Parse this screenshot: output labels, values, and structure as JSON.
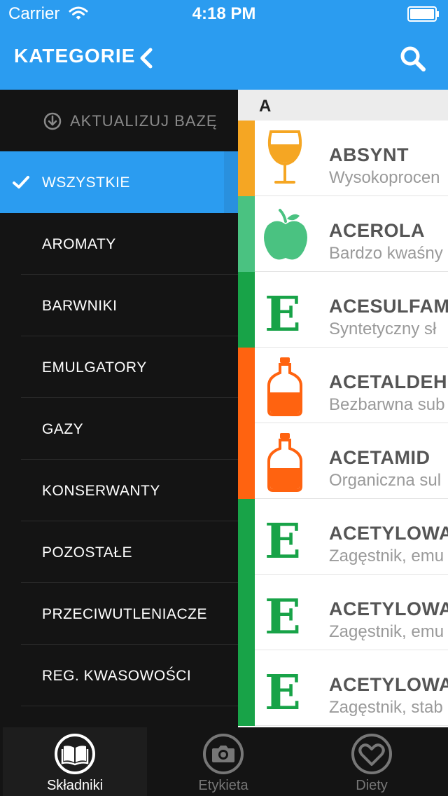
{
  "status_bar": {
    "carrier": "Carrier",
    "time": "4:18 PM"
  },
  "nav": {
    "title": "KATEGORIE"
  },
  "sidebar": {
    "update_label": "AKTUALIZUJ BAZĘ",
    "items": [
      {
        "label": "WSZYSTKIE",
        "active": true
      },
      {
        "label": "AROMATY"
      },
      {
        "label": "BARWNIKI"
      },
      {
        "label": "EMULGATORY"
      },
      {
        "label": "GAZY"
      },
      {
        "label": "KONSERWANTY"
      },
      {
        "label": "POZOSTAŁE"
      },
      {
        "label": "PRZECIWUTLENIACZE"
      },
      {
        "label": "REG. KWASOWOŚCI"
      }
    ]
  },
  "list": {
    "section": "A",
    "rows": [
      {
        "name": "ABSYNT",
        "desc": "Wysokoprocen",
        "icon": "glass-icon",
        "color": "#f5a623"
      },
      {
        "name": "ACEROLA",
        "desc": "Bardzo kwaśny",
        "icon": "apple-icon",
        "color": "#4ac281"
      },
      {
        "name": "ACESULFAM",
        "desc": "Syntetyczny sł",
        "icon": "e-number-icon",
        "color": "#18a348"
      },
      {
        "name": "ACETALDEH",
        "desc": "Bezbarwna sub",
        "icon": "bottle-icon",
        "color": "#ff6310"
      },
      {
        "name": "ACETAMID",
        "desc": "Organiczna sul",
        "icon": "bottle-icon",
        "color": "#ff6310"
      },
      {
        "name": "ACETYLOWA",
        "desc": "Zagęstnik, emu",
        "icon": "e-number-icon",
        "color": "#18a348"
      },
      {
        "name": "ACETYLOWA",
        "desc": "Zagęstnik, emu",
        "icon": "e-number-icon",
        "color": "#18a348"
      },
      {
        "name": "ACETYLOWA",
        "desc": "Zagęstnik, stab",
        "icon": "e-number-icon",
        "color": "#18a348"
      }
    ]
  },
  "tabs": [
    {
      "label": "Składniki",
      "icon": "book-icon",
      "selected": true
    },
    {
      "label": "Etykieta",
      "icon": "camera-icon"
    },
    {
      "label": "Diety",
      "icon": "heart-icon"
    }
  ],
  "colors": {
    "header": "#2b9cf0",
    "sidebar": "#141414"
  }
}
